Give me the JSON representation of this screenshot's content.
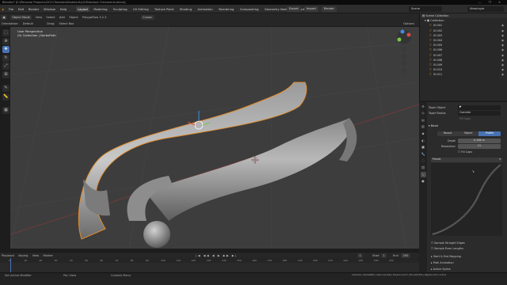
{
  "title_bar": {
    "text": "Blender* [E:\\Personal Projects\\2021\\Tutorials\\Modularity\\01Blockout Ornaments.blend]",
    "window_controls": "— ❐ ✕"
  },
  "top_menu": {
    "logo": "◈",
    "items": [
      "File",
      "Edit",
      "Render",
      "Window",
      "Help"
    ],
    "workspaces": [
      "Layout",
      "Modeling",
      "Sculpting",
      "UV Editing",
      "Texture Paint",
      "Shading",
      "Animation",
      "Rendering",
      "Compositing",
      "Geometry Nodes",
      "Scripting"
    ],
    "active_workspace": "Layout",
    "buttons": [
      "Export",
      "Import",
      "Render"
    ],
    "scene": "Scene",
    "view_layer": "ViewLayer"
  },
  "header": {
    "mode": "Object Mode",
    "menus": [
      "View",
      "Select",
      "Add",
      "Object"
    ],
    "addon": "PolygoFlow 3.2.3",
    "orientation_label": "Orientation:",
    "orientation": "Default",
    "drag_label": "Drag:",
    "drag": "Select Box",
    "pivot": "Cursor",
    "options": "Options"
  },
  "viewport": {
    "perspective": "User Perspective",
    "collection": "(0) Collection | NurbsPath"
  },
  "tools": [
    "select-icon",
    "cursor-icon",
    "move-icon",
    "rotate-icon",
    "scale-icon",
    "transform-icon",
    "annotate-icon",
    "measure-icon",
    "add-cube-icon"
  ],
  "outliner": {
    "header": "Scene Collection",
    "collection": "Collection",
    "items": [
      "IO.001",
      "IO.002",
      "IO.003",
      "IO.004",
      "IO.005",
      "IO.006",
      "IO.007",
      "IO.008",
      "IO.009",
      "IO.010",
      "IO.011"
    ]
  },
  "properties": {
    "taper_object_label": "Taper Object",
    "taper_radius_label": "Taper Radius",
    "taper_radius": "Override",
    "fill_caps_label": "Fill Caps",
    "bevel_section": "Bevel",
    "bevel_modes": [
      "Round",
      "Object",
      "Profile"
    ],
    "bevel_active": "Profile",
    "depth_label": "Depth",
    "depth": "0.166 m",
    "resolution_label": "Resolution",
    "resolution": "11",
    "preset_label": "Preset",
    "sample_straight": "Sample Straight Edges",
    "sample_even": "Sample Even Lengths",
    "start_end": "Start & End Mapping",
    "path_animation": "Path Animation",
    "active_spline": "Active Spline"
  },
  "timeline": {
    "menus": [
      "Playback",
      "Keying",
      "View",
      "Marker"
    ],
    "current_frame": "1",
    "start_label": "Start",
    "start": "1",
    "end_label": "End",
    "end": "250",
    "ticks": [
      "0",
      "10",
      "20",
      "30",
      "40",
      "50",
      "60",
      "70",
      "80",
      "90",
      "100",
      "110",
      "120",
      "130",
      "140",
      "150",
      "160",
      "170",
      "180",
      "190",
      "200",
      "210",
      "220",
      "230",
      "240",
      "250"
    ]
  },
  "status_bar": {
    "left": "Set Active Modifier",
    "pan": "Pan View",
    "context": "Context Menu",
    "right": "Collection | NurbsPath | Verts:112,445 | Faces:111,417 | Tris:222,834 | Objects:1/37 | 2.93.4"
  },
  "colors": {
    "accent": "#4772b3",
    "selection": "#e08d30",
    "viewport_bg": "#3d3d3d"
  }
}
